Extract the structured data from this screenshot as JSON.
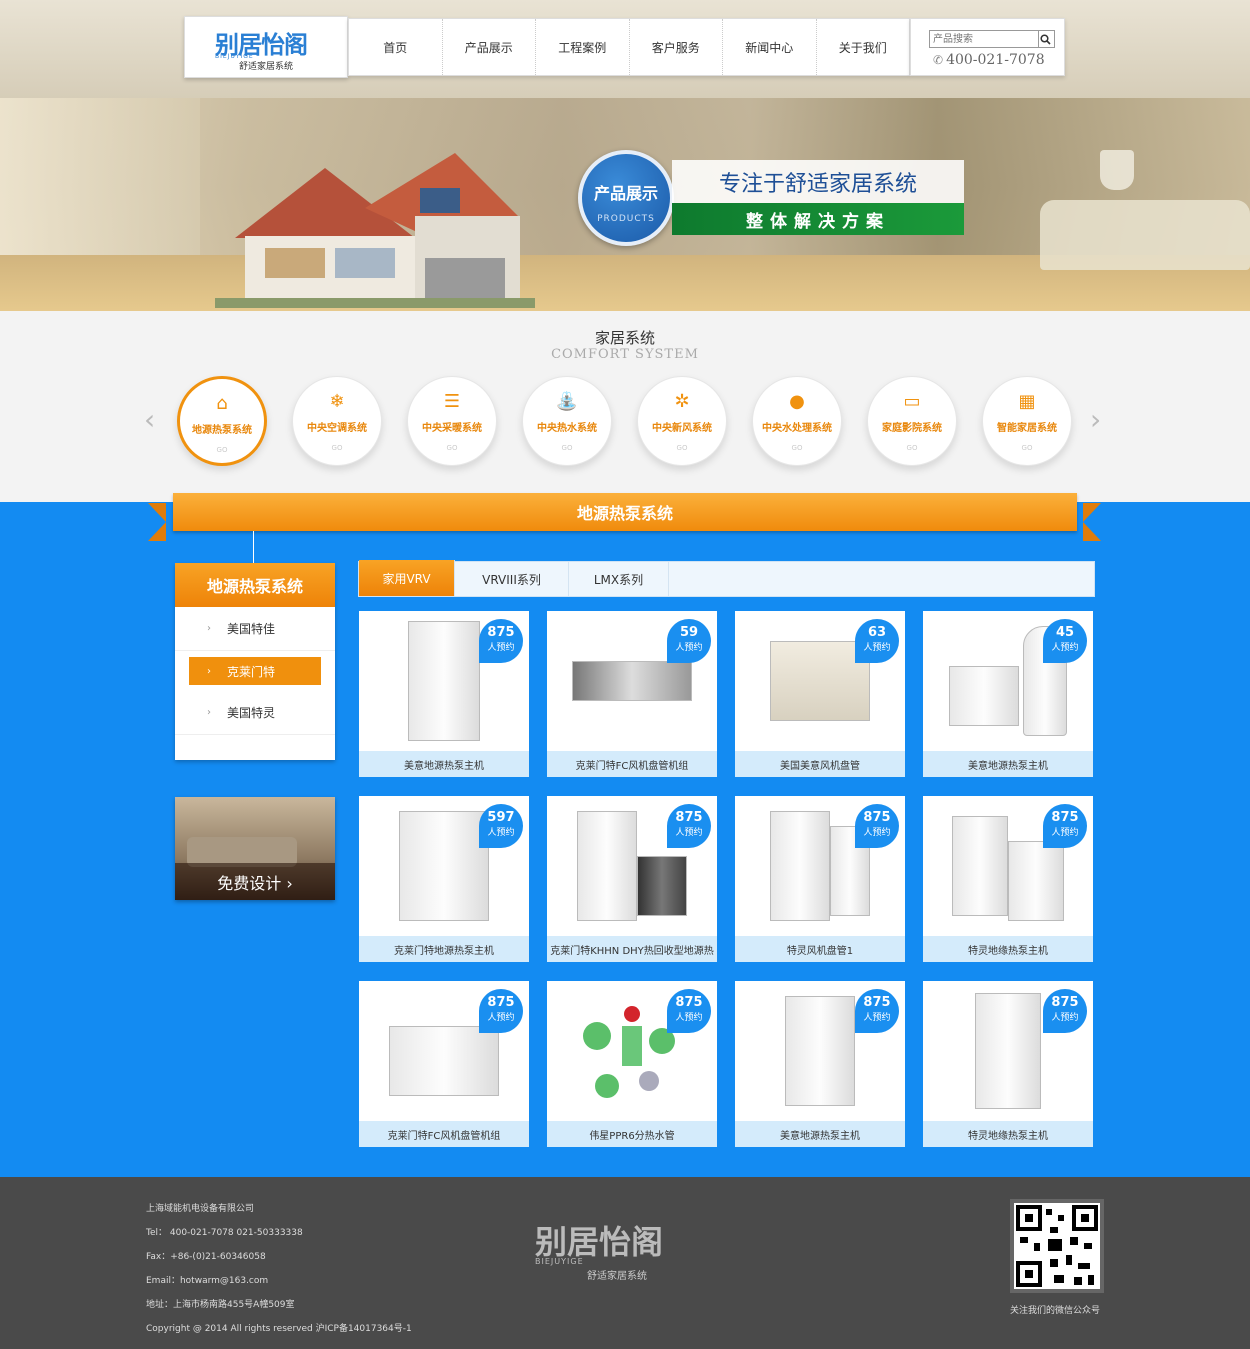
{
  "header": {
    "logo_cn": "别居怡阁",
    "logo_en": "BIEJUYIGE",
    "logo_tagline": "舒适家居系统",
    "nav": [
      "首页",
      "产品展示",
      "工程案例",
      "客户服务",
      "新闻中心",
      "关于我们"
    ],
    "search_placeholder": "产品搜索",
    "phone": "400-021-7078"
  },
  "banner": {
    "badge_title": "产品展示",
    "badge_sub": "PRODUCTS",
    "slogan": "专注于舒适家居系统",
    "slogan2": "整体解决方案"
  },
  "systems": {
    "title": "家居系统",
    "subtitle": "COMFORT SYSTEM",
    "items": [
      {
        "label": "地源热泵系统",
        "go": "GO"
      },
      {
        "label": "中央空调系统",
        "go": "GO"
      },
      {
        "label": "中央采暖系统",
        "go": "GO"
      },
      {
        "label": "中央热水系统",
        "go": "GO"
      },
      {
        "label": "中央新风系统",
        "go": "GO"
      },
      {
        "label": "中央水处理系统",
        "go": "GO"
      },
      {
        "label": "家庭影院系统",
        "go": "GO"
      },
      {
        "label": "智能家居系统",
        "go": "GO"
      }
    ]
  },
  "section_title": "地源热泵系统",
  "sidebar": {
    "title": "地源热泵系统",
    "items": [
      "美国特佳",
      "克莱门特",
      "美国特灵"
    ],
    "free_design": "免费设计 ›"
  },
  "tabs": [
    "家用VRV",
    "VRVIII系列",
    "LMX系列"
  ],
  "products": [
    {
      "name": "美意地源热泵主机",
      "count": "875",
      "label": "人预约"
    },
    {
      "name": "克莱门特FC风机盘管机组",
      "count": "59",
      "label": "人预约"
    },
    {
      "name": "美国美意风机盘管",
      "count": "63",
      "label": "人预约"
    },
    {
      "name": "美意地源热泵主机",
      "count": "45",
      "label": "人预约"
    },
    {
      "name": "克莱门特地源热泵主机",
      "count": "597",
      "label": "人预约"
    },
    {
      "name": "克莱门特KHHN DHY热回收型地源热",
      "count": "875",
      "label": "人预约"
    },
    {
      "name": "特灵风机盘管1",
      "count": "875",
      "label": "人预约"
    },
    {
      "name": "特灵地缘热泵主机",
      "count": "875",
      "label": "人预约"
    },
    {
      "name": "克莱门特FC风机盘管机组",
      "count": "875",
      "label": "人预约"
    },
    {
      "name": "伟星PPR6分热水管",
      "count": "875",
      "label": "人预约"
    },
    {
      "name": "美意地源热泵主机",
      "count": "875",
      "label": "人预约"
    },
    {
      "name": "特灵地缘热泵主机",
      "count": "875",
      "label": "人预约"
    }
  ],
  "footer": {
    "company": "上海域能机电设备有限公司",
    "tel": "Tel： 400-021-7078  021-50333338",
    "fax": "Fax：+86-(0)21-60346058",
    "email": "Email：hotwarm@163.com",
    "address": "地址：上海市杨南路455号A幢509室",
    "copyright": "Copyright @ 2014 All rights reserved 沪ICP备14017364号-1",
    "qr_caption": "关注我们的微信公众号"
  }
}
